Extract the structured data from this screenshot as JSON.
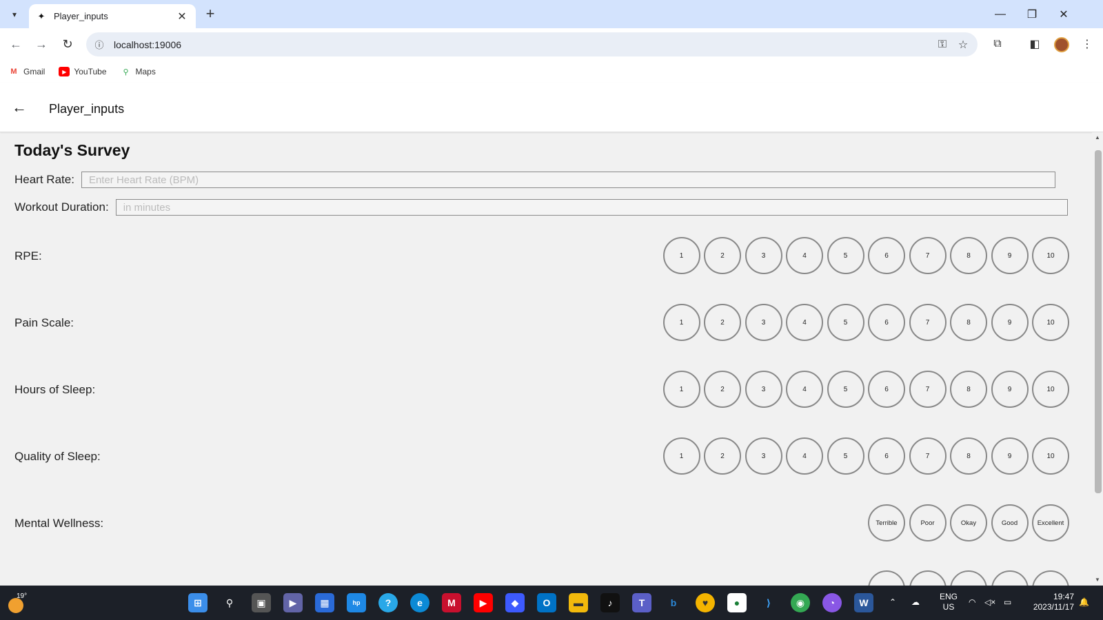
{
  "browser": {
    "tab_title": "Player_inputs",
    "new_tab": "+",
    "url": "localhost:19006",
    "bookmarks": [
      {
        "label": "Gmail",
        "icon": "gmail-icon",
        "color": "#ea4335"
      },
      {
        "label": "YouTube",
        "icon": "youtube-icon",
        "color": "#ff0000"
      },
      {
        "label": "Maps",
        "icon": "maps-icon",
        "color": "#34a853"
      }
    ]
  },
  "app": {
    "title": "Player_inputs",
    "survey_title": "Today's Survey",
    "heart_rate": {
      "label": "Heart Rate:",
      "placeholder": "Enter Heart Rate (BPM)",
      "value": ""
    },
    "workout_duration": {
      "label": "Workout Duration:",
      "placeholder": "in minutes",
      "value": ""
    },
    "scales": [
      {
        "label": "RPE:",
        "options": [
          "1",
          "2",
          "3",
          "4",
          "5",
          "6",
          "7",
          "8",
          "9",
          "10"
        ]
      },
      {
        "label": "Pain Scale:",
        "options": [
          "1",
          "2",
          "3",
          "4",
          "5",
          "6",
          "7",
          "8",
          "9",
          "10"
        ]
      },
      {
        "label": "Hours of Sleep:",
        "options": [
          "1",
          "2",
          "3",
          "4",
          "5",
          "6",
          "7",
          "8",
          "9",
          "10"
        ]
      },
      {
        "label": "Quality of Sleep:",
        "options": [
          "1",
          "2",
          "3",
          "4",
          "5",
          "6",
          "7",
          "8",
          "9",
          "10"
        ]
      },
      {
        "label": "Mental Wellness:",
        "options": [
          "Terrible",
          "Poor",
          "Okay",
          "Good",
          "Excellent"
        ]
      }
    ]
  },
  "taskbar": {
    "temperature": "19°",
    "lang": "ENG",
    "region": "US",
    "time": "19:47",
    "date": "2023/11/17"
  },
  "colors": {
    "tabbar_bg": "#d3e3fd",
    "page_bg": "#f1f1f1",
    "circle_border": "#888888",
    "taskbar_bg": "#1c2028"
  }
}
